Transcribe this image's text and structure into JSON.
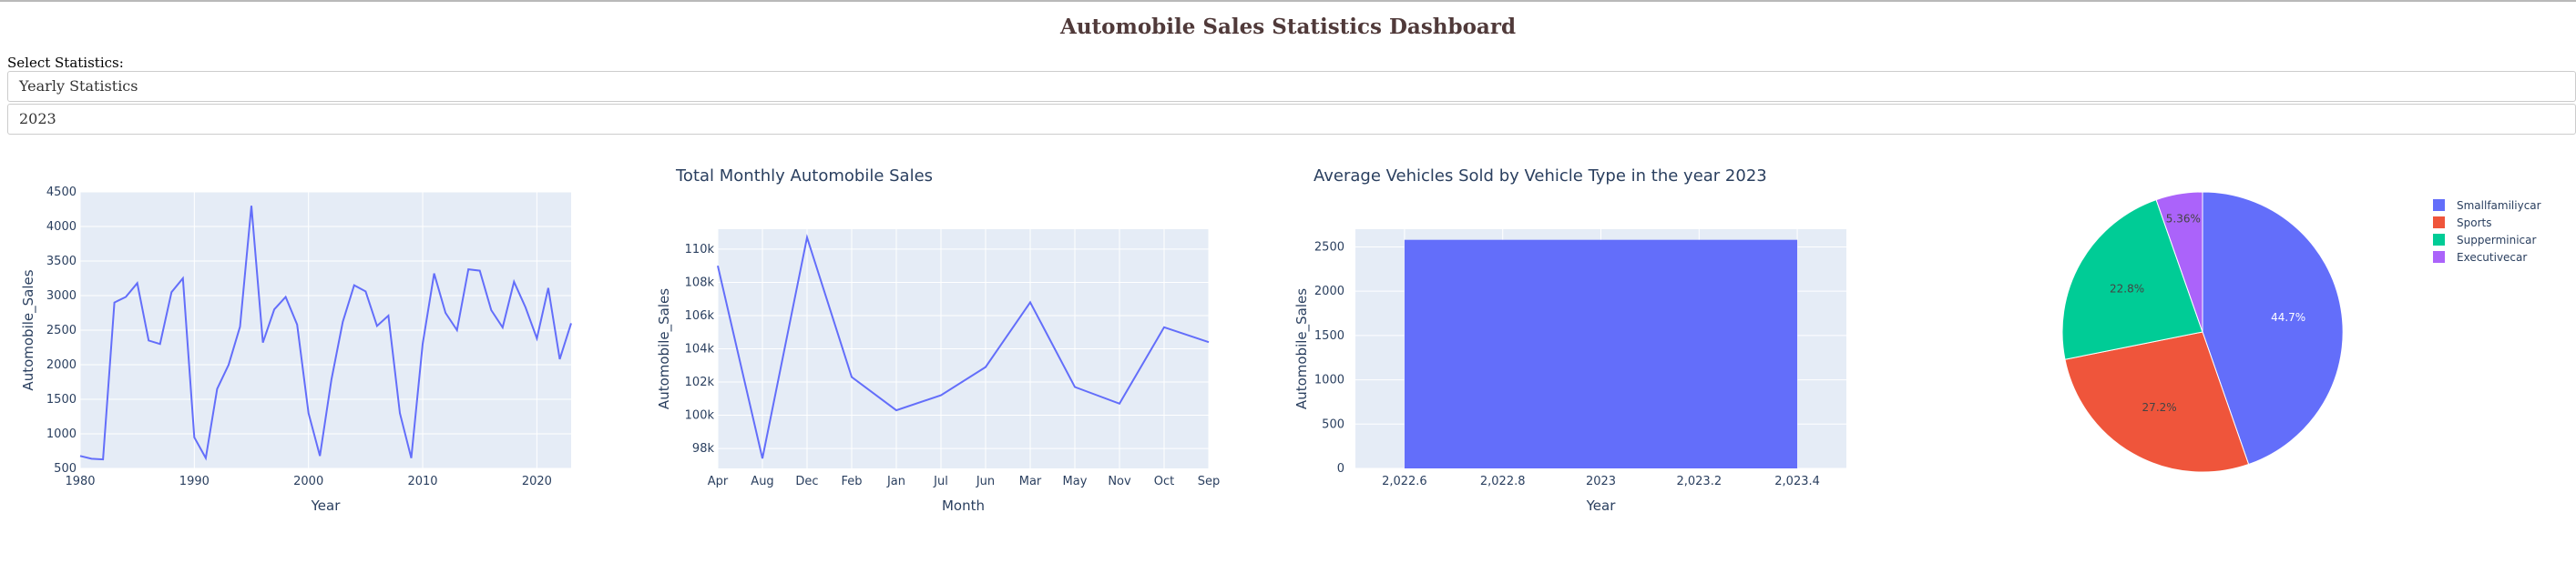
{
  "page_title": "Automobile Sales Statistics Dashboard",
  "select_label": "Select Statistics:",
  "dropdowns": {
    "statistics": "Yearly Statistics",
    "year": "2023"
  },
  "colors": {
    "line": "#636efa",
    "bar": "#636efa",
    "pie": [
      "#636efa",
      "#EF553B",
      "#00cc96",
      "#ab63fa"
    ],
    "plot_bg": "#E5ECF6",
    "title": "#503A3A",
    "text": "#2a3f5f"
  },
  "chart_data": [
    {
      "type": "line",
      "title": "",
      "xlabel": "Year",
      "ylabel": "Automobile_Sales",
      "xlim": [
        1980,
        2023
      ],
      "ylim": [
        500,
        4500
      ],
      "x_ticks": [
        1980,
        1990,
        2000,
        2010,
        2020
      ],
      "x_tick_labels": [
        "1980",
        "1990",
        "2000",
        "2010",
        "2020"
      ],
      "y_ticks": [
        500,
        1000,
        1500,
        2000,
        2500,
        3000,
        3500,
        4000,
        4500
      ],
      "y_tick_labels": [
        "500",
        "1000",
        "1500",
        "2000",
        "2500",
        "3000",
        "3500",
        "4000",
        "4500"
      ],
      "x": [
        1980,
        1981,
        1982,
        1983,
        1984,
        1985,
        1986,
        1987,
        1988,
        1989,
        1990,
        1991,
        1992,
        1993,
        1994,
        1995,
        1996,
        1997,
        1998,
        1999,
        2000,
        2001,
        2002,
        2003,
        2004,
        2005,
        2006,
        2007,
        2008,
        2009,
        2010,
        2011,
        2012,
        2013,
        2014,
        2015,
        2016,
        2017,
        2018,
        2019,
        2020,
        2021,
        2022,
        2023
      ],
      "y": [
        680,
        640,
        630,
        2900,
        2980,
        3180,
        2350,
        2300,
        3050,
        3250,
        950,
        650,
        1650,
        2000,
        2550,
        4300,
        2320,
        2800,
        2980,
        2580,
        1300,
        680,
        1780,
        2620,
        3150,
        3060,
        2560,
        2710,
        1300,
        650,
        2300,
        3320,
        2750,
        2500,
        3380,
        3360,
        2790,
        2540,
        3200,
        2830,
        2380,
        3110,
        2080,
        2600
      ]
    },
    {
      "type": "line",
      "title": "Total Monthly Automobile Sales",
      "xlabel": "Month",
      "ylabel": "Automobile_Sales",
      "ylim": [
        96800,
        111200
      ],
      "y_ticks": [
        98000,
        100000,
        102000,
        104000,
        106000,
        108000,
        110000
      ],
      "y_tick_labels": [
        "98k",
        "100k",
        "102k",
        "104k",
        "106k",
        "108k",
        "110k"
      ],
      "categories": [
        "Apr",
        "Aug",
        "Dec",
        "Feb",
        "Jan",
        "Jul",
        "Jun",
        "Mar",
        "May",
        "Nov",
        "Oct",
        "Sep"
      ],
      "values": [
        109000,
        97400,
        110700,
        102300,
        100300,
        101200,
        102900,
        106800,
        101700,
        100700,
        105300,
        104400
      ]
    },
    {
      "type": "bar",
      "title": "Average Vehicles Sold by Vehicle Type in the year 2023",
      "xlabel": "Year",
      "ylabel": "Automobile_Sales",
      "xlim": [
        2022.5,
        2023.5
      ],
      "ylim": [
        0,
        2700
      ],
      "x_ticks": [
        2022.6,
        2022.8,
        2023,
        2023.2,
        2023.4
      ],
      "x_tick_labels": [
        "2,022.6",
        "2,022.8",
        "2023",
        "2,023.2",
        "2,023.4"
      ],
      "y_ticks": [
        0,
        500,
        1000,
        1500,
        2000,
        2500
      ],
      "y_tick_labels": [
        "0",
        "500",
        "1000",
        "1500",
        "2000",
        "2500"
      ],
      "x": [
        2023
      ],
      "bar_range": [
        2022.6,
        2023.4
      ],
      "values": [
        2580
      ]
    },
    {
      "type": "pie",
      "title": "",
      "labels": [
        "Smallfamiliycar",
        "Sports",
        "Supperminicar",
        "Executivecar"
      ],
      "values": [
        44.7,
        27.2,
        22.8,
        5.36
      ],
      "slice_labels": [
        "44.7%",
        "27.2%",
        "22.8%",
        "5.36%"
      ],
      "legend_placement": "top-right"
    }
  ]
}
